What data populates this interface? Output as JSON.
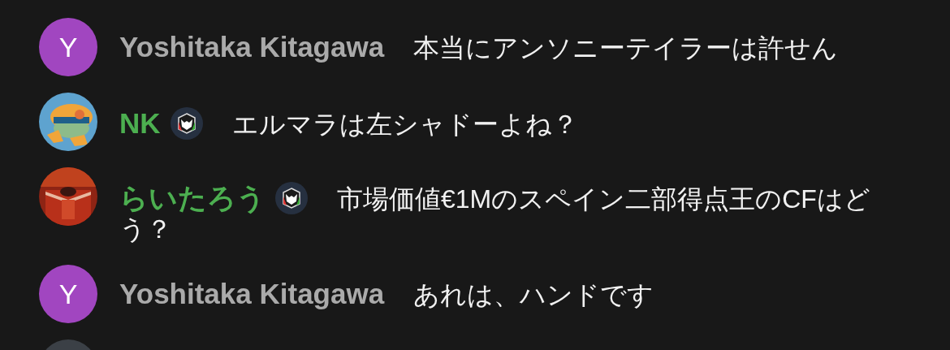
{
  "chat_messages": [
    {
      "avatar": {
        "kind": "letter",
        "letter": "Y",
        "color": "#a146c0"
      },
      "author": "Yoshitaka Kitagawa",
      "member": false,
      "message_lines": [
        "本当にアンソニーテイラーは許せん"
      ]
    },
    {
      "avatar": {
        "kind": "picture"
      },
      "author": "NK",
      "member": true,
      "message_lines": [
        "エルマラは左シャドーよね？"
      ]
    },
    {
      "avatar": {
        "kind": "picture"
      },
      "author": "らいたろう",
      "member": true,
      "message_lines": [
        "市場価値€1Mのスペイン二部得点王のCFはど",
        "う？"
      ]
    },
    {
      "avatar": {
        "kind": "letter",
        "letter": "Y",
        "color": "#a146c0"
      },
      "author": "Yoshitaka Kitagawa",
      "member": false,
      "message_lines": [
        "あれは、ハンドです"
      ]
    },
    {
      "avatar": {
        "kind": "picture"
      }
    }
  ]
}
